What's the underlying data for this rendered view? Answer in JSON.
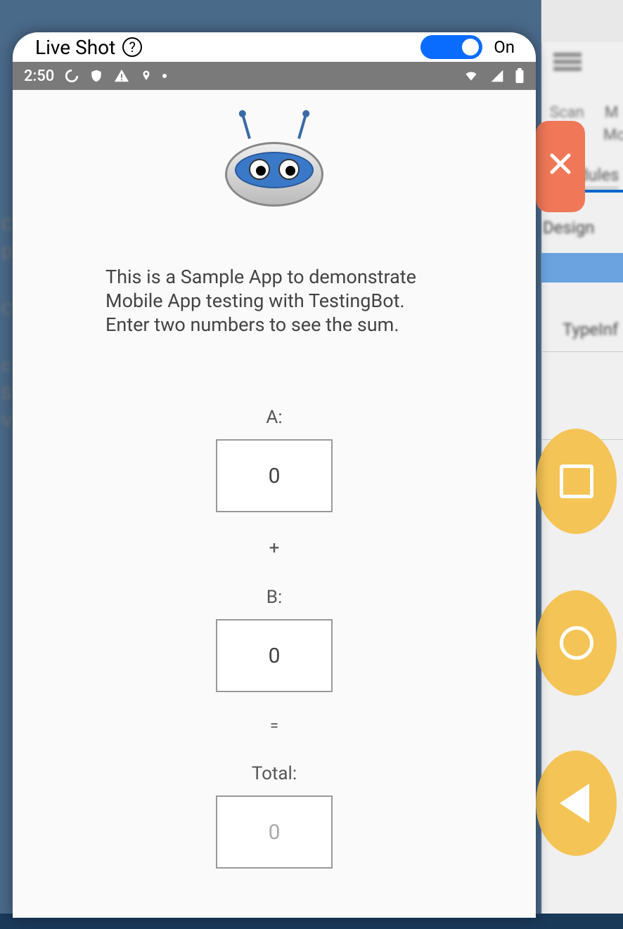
{
  "panel": {
    "title": "Live Shot",
    "toggle_state": "On"
  },
  "status_bar": {
    "time": "2:50"
  },
  "app": {
    "description": "This is a Sample App to demonstrate Mobile App testing with TestingBot. Enter two numbers to see the sum.",
    "labels": {
      "a": "A:",
      "b": "B:",
      "total": "Total:",
      "plus": "+",
      "equals": "="
    },
    "values": {
      "a": "0",
      "b": "0",
      "total": "0"
    }
  },
  "ide": {
    "scan": "Scan",
    "m": "M",
    "mc": "Mc",
    "modules": "Modules",
    "design": "Design",
    "typeinf": "TypeInf"
  }
}
